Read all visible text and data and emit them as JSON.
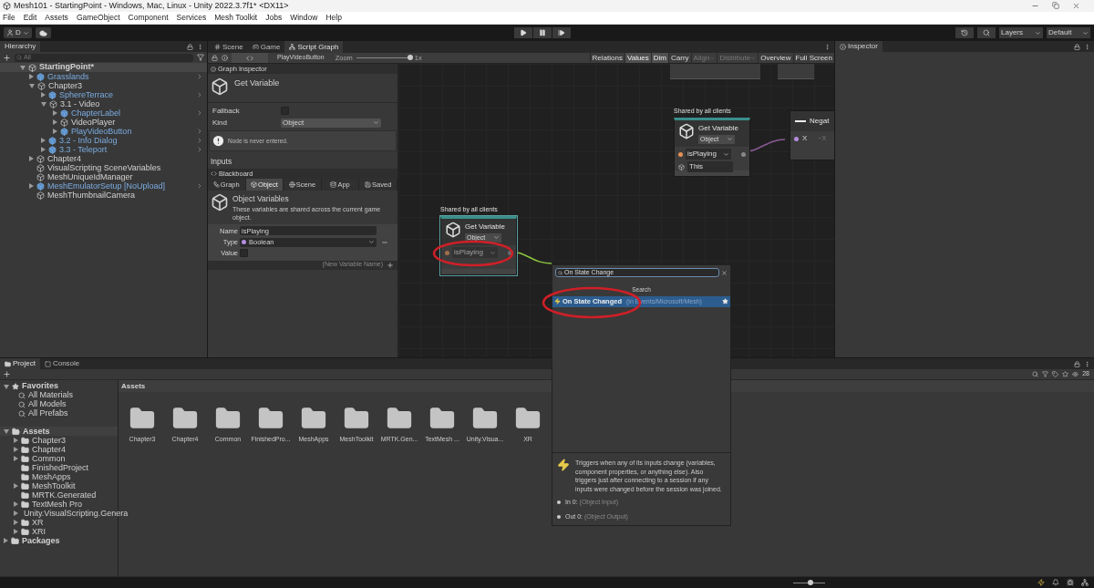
{
  "window": {
    "title": "Mesh101 - StartingPoint - Windows, Mac, Linux - Unity 2022.3.7f1* <DX11>"
  },
  "menu": [
    "File",
    "Edit",
    "Assets",
    "GameObject",
    "Component",
    "Services",
    "Mesh Toolkit",
    "Jobs",
    "Window",
    "Help"
  ],
  "toolbar": {
    "account": "D",
    "layers": "Layers",
    "layout": "Default"
  },
  "hierarchy": {
    "title": "Hierarchy",
    "search_placeholder": "All",
    "scene": "StartingPoint*",
    "items": [
      {
        "name": "Grasslands",
        "prefab": true,
        "kind": "group",
        "expanded": false
      },
      {
        "name": "Chapter3",
        "prefab": false,
        "kind": "group",
        "expanded": true,
        "children": [
          {
            "name": "SphereTerrace",
            "prefab": true,
            "kind": "group",
            "expanded": false
          },
          {
            "name": "3.1 - Video",
            "prefab": false,
            "kind": "group",
            "expanded": true,
            "children": [
              {
                "name": "ChapterLabel",
                "prefab": true,
                "kind": "group",
                "expanded": false
              },
              {
                "name": "VideoPlayer",
                "prefab": false,
                "kind": "group",
                "expanded": false
              },
              {
                "name": "PlayVideoButton",
                "prefab": true,
                "kind": "group",
                "expanded": false
              }
            ]
          },
          {
            "name": "3.2 - Info Dialog",
            "prefab": true,
            "kind": "group",
            "expanded": false
          },
          {
            "name": "3.3 - Teleport",
            "prefab": true,
            "kind": "group",
            "expanded": false
          }
        ]
      },
      {
        "name": "Chapter4",
        "prefab": false,
        "kind": "group",
        "expanded": false
      },
      {
        "name": "VisualScripting SceneVariables",
        "prefab": false,
        "kind": "leaf"
      },
      {
        "name": "MeshUniqueIdManager",
        "prefab": false,
        "kind": "leaf"
      },
      {
        "name": "MeshEmulatorSetup [NoUpload]",
        "prefab": true,
        "kind": "group",
        "expanded": false
      },
      {
        "name": "MeshThumbnailCamera",
        "prefab": false,
        "kind": "leaf"
      }
    ]
  },
  "graph_tabs": [
    {
      "label": "Scene",
      "selected": false
    },
    {
      "label": "Game",
      "selected": false
    },
    {
      "label": "Script Graph",
      "selected": true
    }
  ],
  "graph_toolbar": {
    "graph_name": "PlayVideoButton",
    "zoom_label": "Zoom",
    "zoom": "1x",
    "level": 1,
    "buttons": [
      {
        "label": "Relations",
        "selected": false,
        "disabled": false
      },
      {
        "label": "Values",
        "selected": true,
        "disabled": false
      },
      {
        "label": "Dim",
        "selected": true,
        "disabled": false
      },
      {
        "label": "Carry",
        "selected": false,
        "disabled": false
      },
      {
        "label": "Align",
        "selected": false,
        "disabled": true
      },
      {
        "label": "Distribute",
        "selected": false,
        "disabled": true
      },
      {
        "label": "Overview",
        "selected": false,
        "disabled": false
      },
      {
        "label": "Full Screen",
        "selected": false,
        "disabled": false
      }
    ]
  },
  "graph_inspector": {
    "title": "Graph Inspector",
    "node_title": "Get Variable",
    "fields": [
      {
        "label": "Fallback",
        "kind": "checkbox",
        "checked": false
      },
      {
        "label": "Kind",
        "kind": "dropdown",
        "value": "Object"
      }
    ],
    "warning": "Node is never entered.",
    "section": "Inputs"
  },
  "blackboard": {
    "title": "Blackboard",
    "tabs": [
      {
        "label": "Graph",
        "selected": false
      },
      {
        "label": "Object",
        "selected": true
      },
      {
        "label": "Scene",
        "selected": false
      },
      {
        "label": "App",
        "selected": false
      },
      {
        "label": "Saved",
        "selected": false
      }
    ],
    "heading": "Object Variables",
    "description": "These variables are shared across the current game object.",
    "variable": {
      "name_label": "Name",
      "name": "isPlaying",
      "type_label": "Type",
      "type": "Boolean",
      "value_label": "Value",
      "value": false
    },
    "new_placeholder": "(New Variable Name)"
  },
  "nodes": [
    {
      "header": "Shared by all clients",
      "title": "Get Variable",
      "kind": "Object",
      "variable": "isPlaying",
      "target": "This",
      "dimmed": false
    },
    {
      "header": "Shared by all clients",
      "title": "Get Variable",
      "kind": "Object",
      "variable": "isPlaying",
      "dimmed": true
    }
  ],
  "negate_node": {
    "title": "Negat",
    "input": "X",
    "output": "~X"
  },
  "inspector": {
    "title": "Inspector"
  },
  "search_popup": {
    "query": "On State Change",
    "section": "Search",
    "results": [
      {
        "label": "On State Changed",
        "path": "(in Events/Microsoft/Mesh)",
        "selected": true
      }
    ],
    "description": "Triggers when any of its inputs change (variables, component properties, or anything else). Also triggers just after connecting to a session if any inputs were changed before the session was joined.",
    "ports": [
      {
        "label": "In 0:",
        "type": "(Object Input)"
      },
      {
        "label": "Out 0:",
        "type": "(Object Output)"
      }
    ]
  },
  "project": {
    "tabs": [
      {
        "label": "Project",
        "selected": true
      },
      {
        "label": "Console",
        "selected": false
      }
    ],
    "hidden_count": "28",
    "favorites": {
      "title": "Favorites",
      "items": [
        "All Materials",
        "All Models",
        "All Prefabs"
      ]
    },
    "tree": [
      {
        "name": "Assets",
        "kind": "group",
        "expanded": true,
        "children": [
          {
            "name": "Chapter3",
            "kind": "group",
            "expanded": false
          },
          {
            "name": "Chapter4",
            "kind": "group",
            "expanded": false
          },
          {
            "name": "Common",
            "kind": "group",
            "expanded": false
          },
          {
            "name": "FinishedProject",
            "kind": "leaf"
          },
          {
            "name": "MeshApps",
            "kind": "leaf"
          },
          {
            "name": "MeshToolkit",
            "kind": "group",
            "expanded": false
          },
          {
            "name": "MRTK.Generated",
            "kind": "leaf"
          },
          {
            "name": "TextMesh Pro",
            "kind": "group",
            "expanded": false
          },
          {
            "name": "Unity.VisualScripting.Genera",
            "kind": "group",
            "expanded": false
          },
          {
            "name": "XR",
            "kind": "group",
            "expanded": false
          },
          {
            "name": "XRI",
            "kind": "group",
            "expanded": false
          }
        ]
      },
      {
        "name": "Packages",
        "kind": "group",
        "expanded": false
      }
    ],
    "grid_title": "Assets",
    "folders": [
      "Chapter3",
      "Chapter4",
      "Common",
      "FinishedPro...",
      "MeshApps",
      "MeshToolkit",
      "MRTK.Gen...",
      "TextMesh ...",
      "Unity.Visua...",
      "XR"
    ]
  },
  "status_bar": {
    "level": 0.55
  }
}
